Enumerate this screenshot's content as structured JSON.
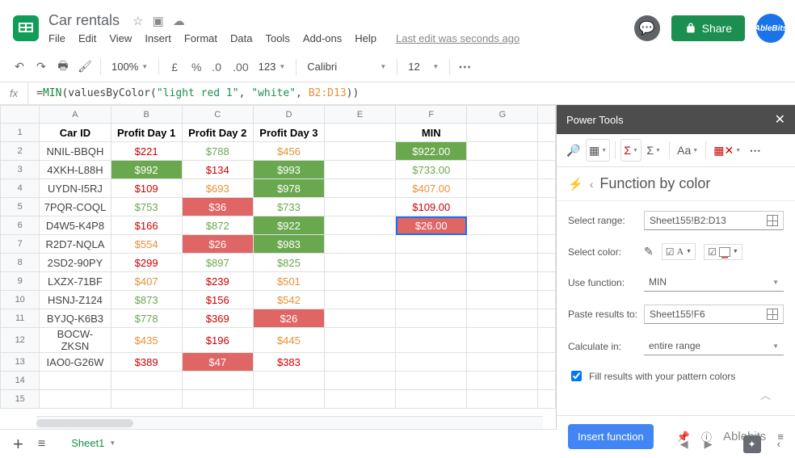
{
  "doc": {
    "title": "Car rentals",
    "last_edit": "Last edit was seconds ago"
  },
  "menu": {
    "file": "File",
    "edit": "Edit",
    "view": "View",
    "insert": "Insert",
    "format": "Format",
    "data": "Data",
    "tools": "Tools",
    "addons": "Add-ons",
    "help": "Help"
  },
  "share": {
    "label": "Share"
  },
  "avatar": {
    "text": "AbleBits"
  },
  "toolbar": {
    "zoom": "100%",
    "currency": "£",
    "percent": "%",
    "font": "Calibri",
    "size": "12",
    "more": "..."
  },
  "formula": {
    "eq": "=",
    "fn": "MIN",
    "inner": "valuesByColor",
    "s1": "\"light red 1\"",
    "s2": "\"white\"",
    "ref": "B2:D13"
  },
  "cols": [
    "A",
    "B",
    "C",
    "D",
    "E",
    "F",
    "G"
  ],
  "headers": {
    "a": "Car ID",
    "b": "Profit Day 1",
    "c": "Profit Day 2",
    "d": "Profit Day 3",
    "f": "MIN"
  },
  "rows": [
    {
      "n": "1"
    },
    {
      "n": "2",
      "a": "NNIL-BBQH",
      "b": "$221",
      "bc": "red-txt",
      "c": "$788",
      "cc": "green-txt",
      "d": "$456",
      "dc": "orange-txt",
      "f": "$922.00",
      "fc": "green-cell"
    },
    {
      "n": "3",
      "a": "4XKH-L88H",
      "b": "$992",
      "bc": "green-cell",
      "c": "$134",
      "cc": "red-txt",
      "d": "$993",
      "dc": "green-cell",
      "f": "$733.00",
      "fc": "green-txt"
    },
    {
      "n": "4",
      "a": "UYDN-I5RJ",
      "b": "$109",
      "bc": "red-txt",
      "c": "$693",
      "cc": "orange-txt",
      "d": "$978",
      "dc": "green-cell",
      "f": "$407.00",
      "fc": "orange-txt"
    },
    {
      "n": "5",
      "a": "7PQR-COQL",
      "b": "$753",
      "bc": "green-txt",
      "c": "$36",
      "cc": "red-cell",
      "d": "$733",
      "dc": "green-txt",
      "f": "$109.00",
      "fc": "red-txt"
    },
    {
      "n": "6",
      "a": "D4W5-K4P8",
      "b": "$166",
      "bc": "red-txt",
      "c": "$872",
      "cc": "green-txt",
      "d": "$922",
      "dc": "green-cell",
      "f": "$26.00",
      "fc": "selected"
    },
    {
      "n": "7",
      "a": "R2D7-NQLA",
      "b": "$554",
      "bc": "orange-txt",
      "c": "$26",
      "cc": "red-cell",
      "d": "$983",
      "dc": "green-cell",
      "f": "",
      "fc": ""
    },
    {
      "n": "8",
      "a": "2SD2-90PY",
      "b": "$299",
      "bc": "red-txt",
      "c": "$897",
      "cc": "green-txt",
      "d": "$825",
      "dc": "green-txt",
      "f": "",
      "fc": ""
    },
    {
      "n": "9",
      "a": "LXZX-71BF",
      "b": "$407",
      "bc": "orange-txt",
      "c": "$239",
      "cc": "red-txt",
      "d": "$501",
      "dc": "orange-txt",
      "f": "",
      "fc": ""
    },
    {
      "n": "10",
      "a": "HSNJ-Z124",
      "b": "$873",
      "bc": "green-txt",
      "c": "$156",
      "cc": "red-txt",
      "d": "$542",
      "dc": "orange-txt",
      "f": "",
      "fc": ""
    },
    {
      "n": "11",
      "a": "BYJQ-K6B3",
      "b": "$778",
      "bc": "green-txt",
      "c": "$369",
      "cc": "red-txt",
      "d": "$26",
      "dc": "red-cell",
      "f": "",
      "fc": ""
    },
    {
      "n": "12",
      "a": "BOCW-ZKSN",
      "b": "$435",
      "bc": "orange-txt",
      "c": "$196",
      "cc": "red-txt",
      "d": "$445",
      "dc": "orange-txt",
      "f": "",
      "fc": ""
    },
    {
      "n": "13",
      "a": "IAO0-G26W",
      "b": "$389",
      "bc": "red-txt",
      "c": "$47",
      "cc": "red-cell",
      "d": "$383",
      "dc": "red-txt",
      "f": "",
      "fc": ""
    },
    {
      "n": "14"
    },
    {
      "n": "15"
    }
  ],
  "panel": {
    "title": "Power Tools",
    "crumb": "Function by color",
    "select_range_label": "Select range:",
    "select_range_value": "Sheet155!B2:D13",
    "select_color_label": "Select color:",
    "use_function_label": "Use function:",
    "use_function_value": "MIN",
    "paste_to_label": "Paste results to:",
    "paste_to_value": "Sheet155!F6",
    "calc_in_label": "Calculate in:",
    "calc_in_value": "entire range",
    "fill_check": "Fill results with your pattern colors",
    "insert_btn": "Insert function",
    "brand": "Ablebits"
  },
  "tabs": {
    "sheet1": "Sheet1"
  }
}
